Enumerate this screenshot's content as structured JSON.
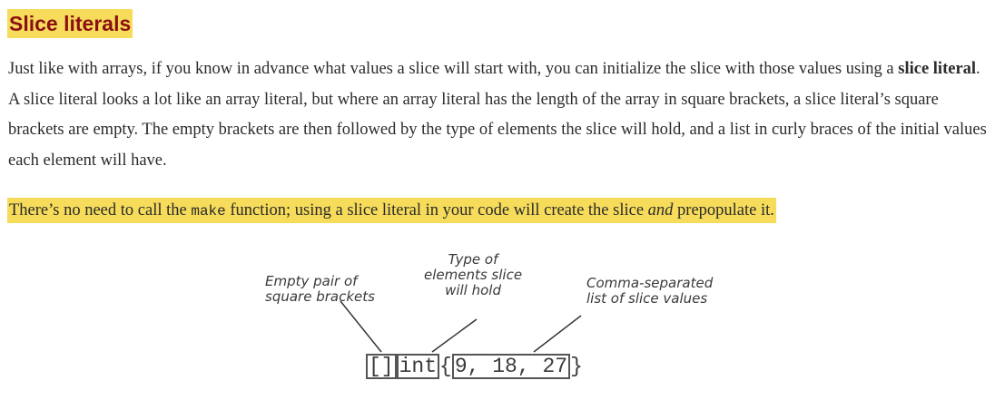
{
  "heading": "Slice literals",
  "paragraph": {
    "before": "Just like with arrays, if you know in advance what values a slice will start with, you can initialize the slice with those values using a ",
    "term": "slice literal",
    "after": ". A slice literal looks a lot like an array literal, but where an array literal has the length of the array in square brackets, a slice literal’s square brackets are empty. The empty brackets are then followed by the type of elements the slice will hold, and a list in curly braces of the initial values each element will have."
  },
  "highlight": {
    "before": "There’s no need to call the ",
    "code": "make",
    "middle": " function; using a slice literal in your code will create the slice ",
    "emphasis": "and",
    "after": " prepopulate it."
  },
  "diagram": {
    "annotations": {
      "brackets": [
        "Empty pair of",
        "square brackets"
      ],
      "type": [
        "Type of",
        "elements slice",
        "will hold"
      ],
      "values": [
        "Comma-separated",
        "list of slice values"
      ]
    },
    "code": {
      "brackets": "[]",
      "type": "int",
      "open_brace": "{",
      "values": "9, 18, 27",
      "close_brace": "}"
    }
  }
}
